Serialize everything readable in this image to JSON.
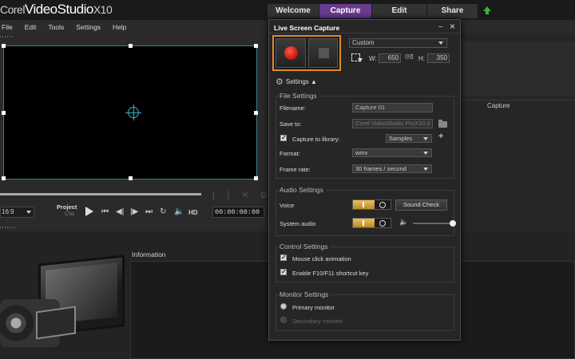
{
  "app": {
    "title_prefix": "Corel",
    "title_name": "VideoStudio",
    "title_version": "X10"
  },
  "tabs": [
    {
      "label": "Welcome"
    },
    {
      "label": "Capture"
    },
    {
      "label": "Edit"
    },
    {
      "label": "Share"
    }
  ],
  "menu": [
    "File",
    "Edit",
    "Tools",
    "Settings",
    "Help"
  ],
  "player": {
    "ratio": "16:9",
    "project_label": "Project",
    "clip_label": "Clip",
    "hd_label": "HD",
    "timecode": "00:00:00:00"
  },
  "right_panel": {
    "capture_label": "Capture"
  },
  "info": {
    "label": "Information"
  },
  "dialog": {
    "title": "Live Screen Capture",
    "minimize": "–",
    "close": "×",
    "preset": "Custom",
    "width_label": "W:",
    "width_value": "650",
    "height_label": "H:",
    "height_value": "350",
    "link_symbol": "ᘓᘔ",
    "settings_label": "Settings",
    "settings_arrow": "▲",
    "file_settings": {
      "title": "File Settings",
      "filename_label": "Filename:",
      "filename_value": "Capture 01",
      "save_to_label": "Save to:",
      "save_to_value": "Corel VideoStudio ProX10.0",
      "capture_to_library_label": "Capture to library:",
      "library_value": "Samples",
      "format_label": "Format:",
      "format_value": "wmv",
      "frame_rate_label": "Frame rate:",
      "frame_rate_value": "30 frames / second"
    },
    "audio_settings": {
      "title": "Audio Settings",
      "voice_label": "Voice",
      "sound_check_label": "Sound Check",
      "system_audio_label": "System audio",
      "system_volume": 1.0
    },
    "control_settings": {
      "title": "Control Settings",
      "mouse_click_label": "Mouse click animation",
      "shortcut_label": "Enable F10/F11 shortcut key"
    },
    "monitor_settings": {
      "title": "Monitor Settings",
      "primary_label": "Primary monitor",
      "secondary_label": "Secondary monitor"
    }
  },
  "colors": {
    "accent_tab": "#6a3b8f",
    "record_red": "#d21a10",
    "highlight_orange": "#e08a2b",
    "toggle_gold": "#d4a844",
    "preview_border": "#3f7f86"
  }
}
